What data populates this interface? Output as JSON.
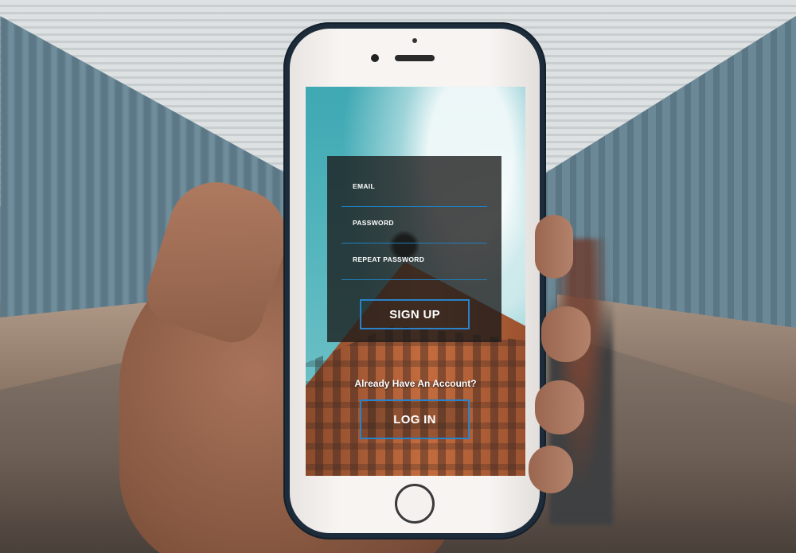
{
  "form": {
    "email_label": "EMAIL",
    "password_label": "PASSWORD",
    "repeat_password_label": "REPEAT PASSWORD",
    "signup_label": "SIGN UP"
  },
  "account_prompt": "Already Have An Account?",
  "login_label": "LOG IN",
  "colors": {
    "accent_border": "#2a82c9",
    "field_underline": "#1f7fc0",
    "panel_bg": "rgba(25,25,25,.78)"
  }
}
